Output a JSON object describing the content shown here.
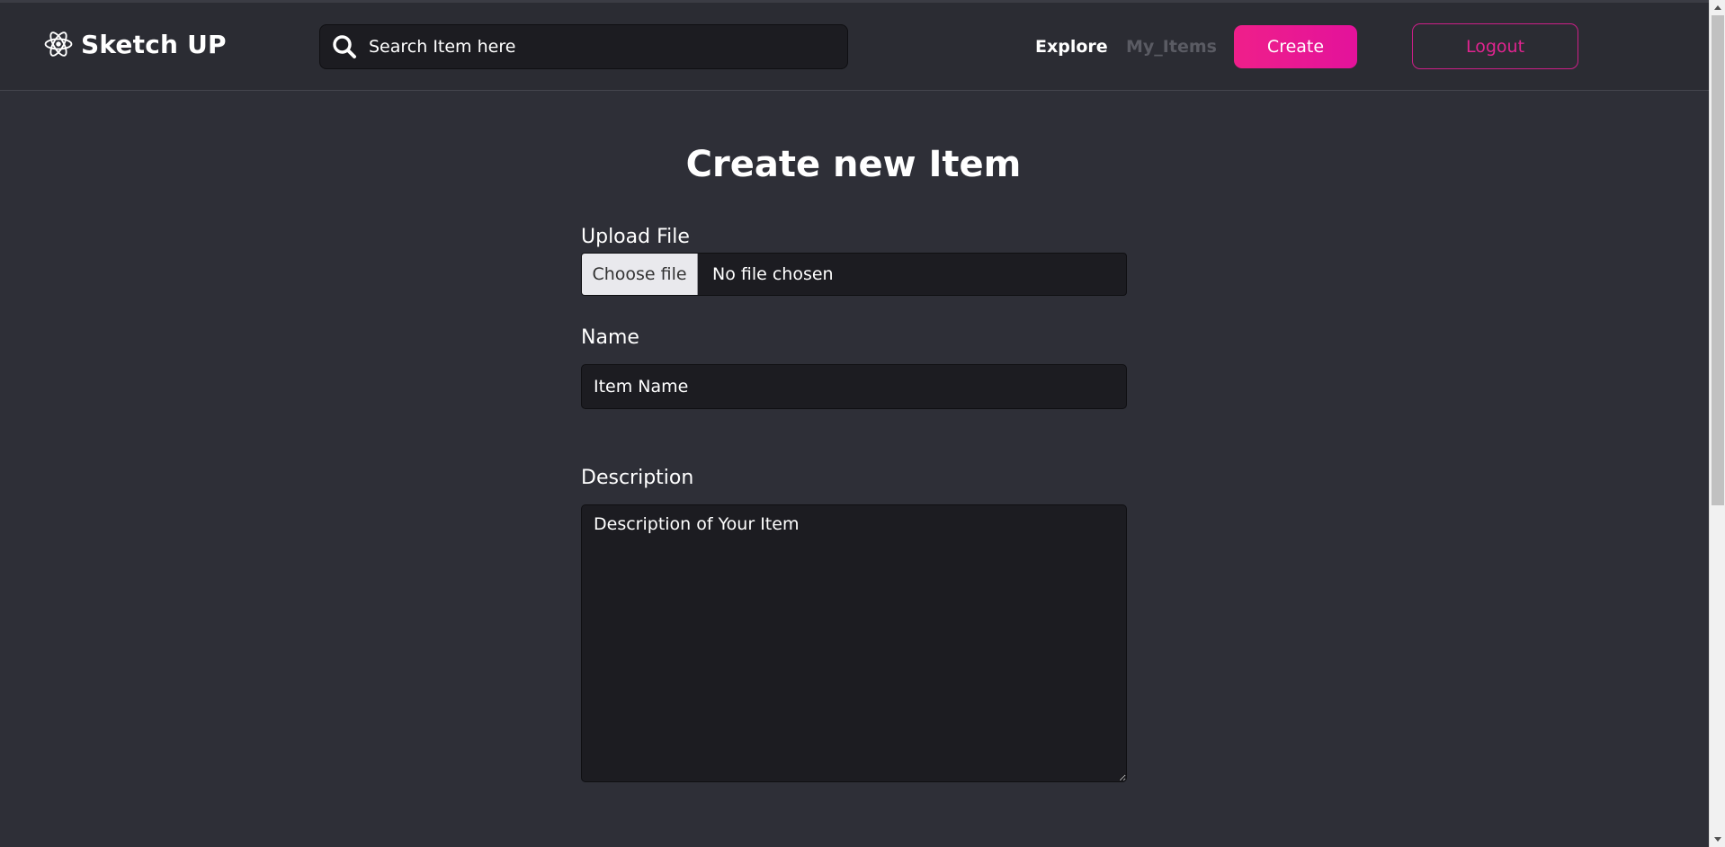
{
  "brand": {
    "name": "Sketch UP",
    "icon": "react-atom-icon"
  },
  "search": {
    "placeholder": "Search Item here",
    "icon": "search-icon"
  },
  "nav": {
    "explore_label": "Explore",
    "my_items_label": "My_Items",
    "create_label": "Create",
    "logout_label": "Logout"
  },
  "form": {
    "title": "Create new Item",
    "upload": {
      "label": "Upload File",
      "button_label": "Choose file",
      "status": "No file chosen"
    },
    "name": {
      "label": "Name",
      "placeholder": "Item Name"
    },
    "description": {
      "label": "Description",
      "placeholder": "Description of Your Item"
    }
  },
  "colors": {
    "background": "#2e2f37",
    "navbar": "#2b2c33",
    "input_bg": "#1c1c21",
    "accent_pink": "#e3129b",
    "muted_link": "#5a5b63"
  }
}
